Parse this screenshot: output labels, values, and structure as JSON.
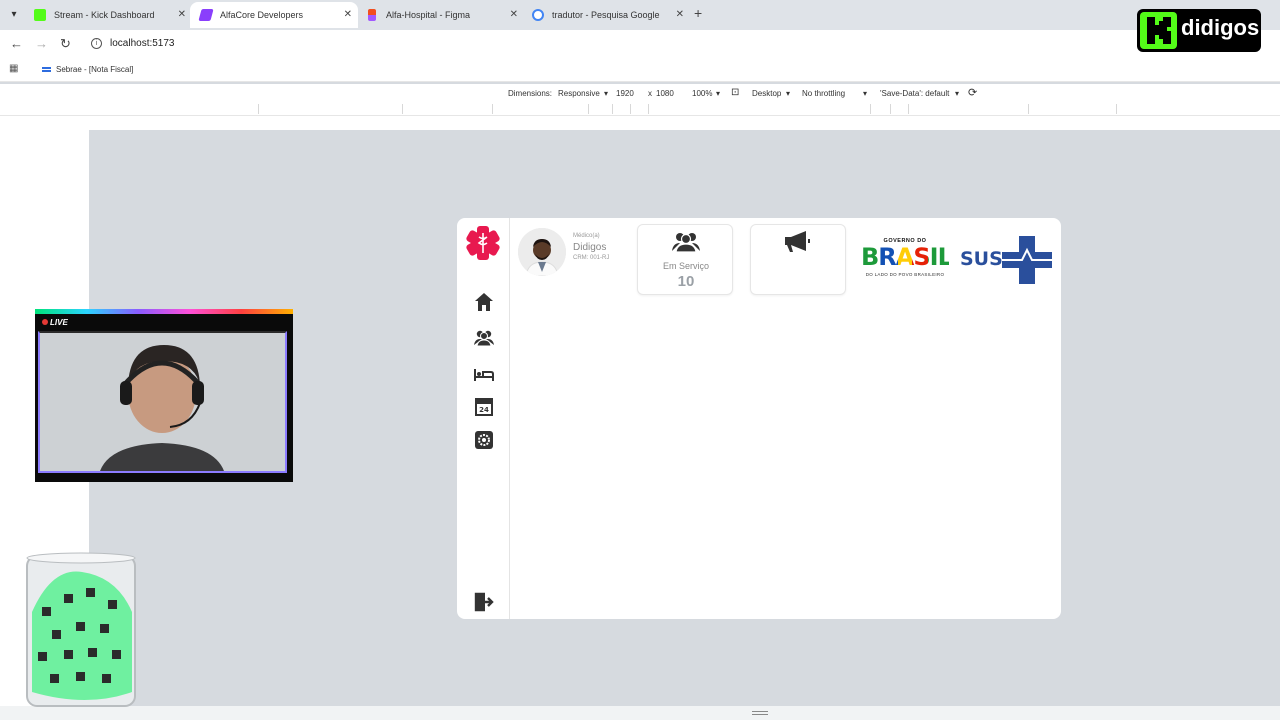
{
  "browser": {
    "tabs": [
      {
        "title": "Stream - Kick Dashboard",
        "favicon_color": "#53fc18",
        "active": false
      },
      {
        "title": "AlfaCore Developers",
        "favicon_color": "#8a3ffc",
        "active": true
      },
      {
        "title": "Alfa-Hospital - Figma",
        "favicon_color": "#f24e1e",
        "active": false
      },
      {
        "title": "tradutor - Pesquisa Google",
        "favicon_color": "#4285f4",
        "active": false
      }
    ],
    "new_tab_icon": "+",
    "tab_close_icon": "✕",
    "url": "localhost:5173",
    "bookmark": "Sebrae - [Nota Fiscal]"
  },
  "devtools": {
    "dimensions_label": "Dimensions:",
    "device": "Responsive",
    "width": "1920",
    "times": "x",
    "height": "1080",
    "zoom": "100%",
    "mode": "Desktop",
    "throttling": "No throttling",
    "save_data": "'Save-Data': default"
  },
  "app": {
    "accent_color": "#e8194f",
    "doctor": {
      "role": "Médico(a)",
      "name": "Didigos",
      "crm": "CRM: 001-RJ"
    },
    "cards": [
      {
        "icon": "users-icon",
        "label": "Em Serviço",
        "value": "10"
      },
      {
        "icon": "megaphone-icon",
        "label": "",
        "value": ""
      }
    ],
    "gov_logo": {
      "top": "GOVERNO DO",
      "main": "BRASIL",
      "bottom": "DO LADO DO POVO BRASILEIRO"
    },
    "sus_logo": "SUS",
    "sidebar": [
      {
        "icon": "home-icon"
      },
      {
        "icon": "users-icon"
      },
      {
        "icon": "bed-icon"
      },
      {
        "icon": "pharmacy-icon"
      },
      {
        "icon": "settings-icon"
      },
      {
        "icon": "logout-icon"
      }
    ]
  },
  "stream": {
    "live_label": "LIVE",
    "channel_logo": "didigos"
  }
}
